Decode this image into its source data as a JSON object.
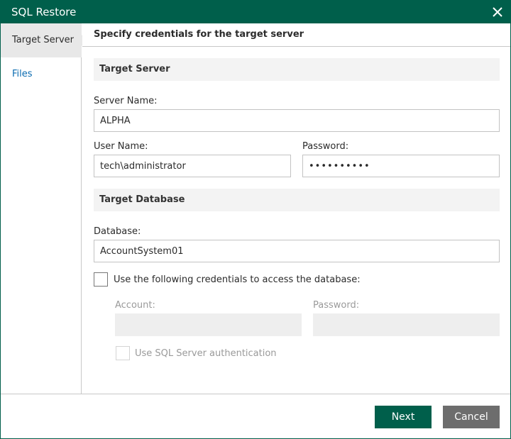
{
  "window": {
    "title": "SQL Restore",
    "close_icon": "close-icon"
  },
  "sidebar": {
    "items": [
      {
        "label": "Target Server",
        "active": true
      },
      {
        "label": "Files",
        "active": false
      }
    ]
  },
  "step": {
    "title": "Specify credentials for the target server"
  },
  "target_server": {
    "section_title": "Target Server",
    "server_name_label": "Server Name:",
    "server_name_value": "ALPHA",
    "user_name_label": "User Name:",
    "user_name_value": "tech\\administrator",
    "password_label": "Password:",
    "password_value": "••••••••••"
  },
  "target_database": {
    "section_title": "Target Database",
    "database_label": "Database:",
    "database_value": "AccountSystem01",
    "use_credentials_label": "Use the following credentials to access the database:",
    "use_credentials_checked": false,
    "account_label": "Account:",
    "account_value": "",
    "password_label": "Password:",
    "password_value": "",
    "sql_auth_label": "Use SQL Server authentication",
    "sql_auth_checked": false
  },
  "footer": {
    "next_label": "Next",
    "cancel_label": "Cancel"
  },
  "colors": {
    "brand": "#005f4b",
    "link": "#0a6bb0",
    "cancel": "#6d6d6d"
  }
}
